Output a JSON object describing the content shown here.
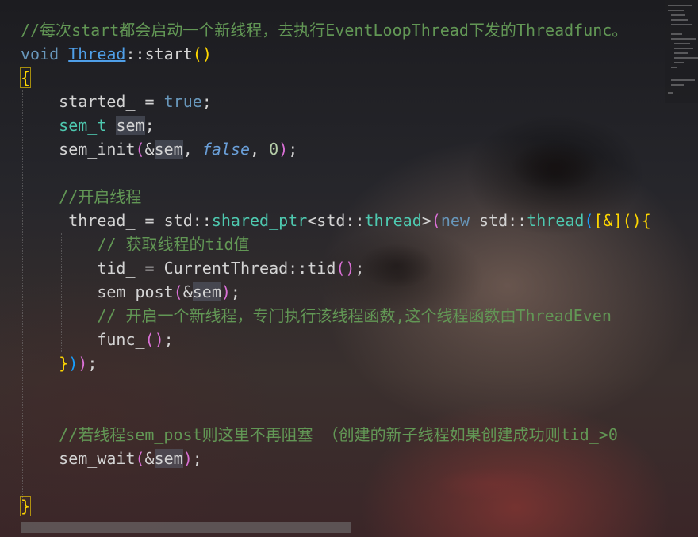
{
  "editor": {
    "lines": [
      {
        "tokens": [
          [
            "c-comment",
            "//每次start都会启动一个新线程，去执行EventLoopThread下发的Threadfunc。"
          ]
        ]
      },
      {
        "tokens": [
          [
            "c-kw2",
            "void "
          ],
          [
            "c-link",
            "Thread"
          ],
          [
            "c-plain",
            "::"
          ],
          [
            "c-plain",
            "start"
          ],
          [
            "c-br",
            "()"
          ]
        ]
      },
      {
        "tokens": [
          [
            "c-br brace-box",
            "{"
          ]
        ]
      },
      {
        "tokens": [
          [
            "c-plain",
            "    started_ = "
          ],
          [
            "c-kw2",
            "true"
          ],
          [
            "c-plain",
            ";"
          ]
        ]
      },
      {
        "tokens": [
          [
            "c-plain",
            "    "
          ],
          [
            "c-type",
            "sem_t"
          ],
          [
            "c-plain",
            " "
          ],
          [
            "c-plain hl",
            "sem"
          ],
          [
            "c-plain",
            ";"
          ]
        ]
      },
      {
        "tokens": [
          [
            "c-plain",
            "    sem_init"
          ],
          [
            "c-br2",
            "("
          ],
          [
            "c-plain",
            "&"
          ],
          [
            "c-plain hl",
            "sem"
          ],
          [
            "c-plain",
            ", "
          ],
          [
            "c-ital",
            "false"
          ],
          [
            "c-plain",
            ", "
          ],
          [
            "c-num",
            "0"
          ],
          [
            "c-br2",
            ")"
          ],
          [
            "c-plain",
            ";"
          ]
        ]
      },
      {
        "tokens": [
          [
            "c-plain",
            ""
          ]
        ]
      },
      {
        "tokens": [
          [
            "c-comment",
            "    //开启线程"
          ]
        ]
      },
      {
        "tokens": [
          [
            "c-plain",
            "     thread_ = std::"
          ],
          [
            "c-type",
            "shared_ptr"
          ],
          [
            "c-plain",
            "<std::"
          ],
          [
            "c-type",
            "thread"
          ],
          [
            "c-plain",
            ">"
          ],
          [
            "c-br2",
            "("
          ],
          [
            "c-kw2",
            "new"
          ],
          [
            "c-plain",
            " std::"
          ],
          [
            "c-type",
            "thread"
          ],
          [
            "c-br3",
            "("
          ],
          [
            "c-br",
            "[&]"
          ],
          [
            "c-br",
            "(){"
          ]
        ]
      },
      {
        "tokens": [
          [
            "c-comment",
            "        // 获取线程的tid值"
          ]
        ]
      },
      {
        "tokens": [
          [
            "c-plain",
            "        tid_ = CurrentThread::tid"
          ],
          [
            "c-br2",
            "()"
          ],
          [
            "c-plain",
            ";"
          ]
        ]
      },
      {
        "tokens": [
          [
            "c-plain",
            "        sem_post"
          ],
          [
            "c-br2",
            "("
          ],
          [
            "c-plain",
            "&"
          ],
          [
            "c-plain hl",
            "sem"
          ],
          [
            "c-br2",
            ")"
          ],
          [
            "c-plain",
            ";"
          ]
        ]
      },
      {
        "tokens": [
          [
            "c-comment",
            "        // 开启一个新线程，专门执行该线程函数,这个线程函数由ThreadEven"
          ]
        ]
      },
      {
        "tokens": [
          [
            "c-plain",
            "        func_"
          ],
          [
            "c-br2",
            "()"
          ],
          [
            "c-plain",
            ";"
          ]
        ]
      },
      {
        "tokens": [
          [
            "c-plain",
            "    "
          ],
          [
            "c-br",
            "}"
          ],
          [
            "c-br3",
            ")"
          ],
          [
            "c-br2",
            ")"
          ],
          [
            "c-plain",
            ";"
          ]
        ]
      },
      {
        "tokens": [
          [
            "c-plain",
            ""
          ]
        ]
      },
      {
        "tokens": [
          [
            "c-plain",
            ""
          ]
        ]
      },
      {
        "tokens": [
          [
            "c-comment",
            "    //若线程sem_post则这里不再阻塞 （创建的新子线程如果创建成功则tid_>0"
          ]
        ]
      },
      {
        "tokens": [
          [
            "c-plain",
            "    sem_wait"
          ],
          [
            "c-br2",
            "("
          ],
          [
            "c-plain",
            "&"
          ],
          [
            "c-plain hl",
            "sem"
          ],
          [
            "c-br2",
            ")"
          ],
          [
            "c-plain",
            ";"
          ]
        ]
      },
      {
        "tokens": [
          [
            "c-plain",
            ""
          ]
        ]
      },
      {
        "tokens": [
          [
            "c-br brace-box",
            "}"
          ]
        ]
      }
    ]
  }
}
